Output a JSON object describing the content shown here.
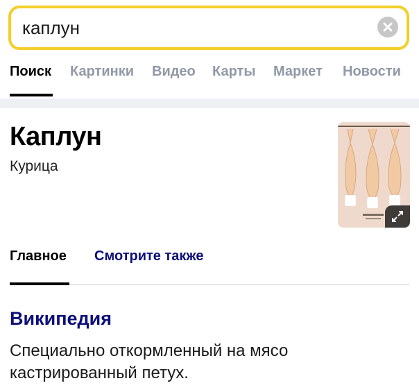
{
  "search": {
    "query": "каплун",
    "clear_icon": "clear-icon"
  },
  "tabs": [
    {
      "label": "Поиск",
      "active": true
    },
    {
      "label": "Картинки",
      "active": false
    },
    {
      "label": "Видео",
      "active": false
    },
    {
      "label": "Карты",
      "active": false
    },
    {
      "label": "Маркет",
      "active": false
    },
    {
      "label": "Новости",
      "active": false
    }
  ],
  "entity": {
    "title": "Каплун",
    "subtitle": "Курица",
    "image_icon": "poultry-image",
    "expand_icon": "expand-icon"
  },
  "card_tabs": [
    {
      "label": "Главное",
      "active": true
    },
    {
      "label": "Смотрите также",
      "active": false
    }
  ],
  "wiki": {
    "source": "Википедия",
    "text": "Специально откормленный на мясо кастрированный петух."
  },
  "colors": {
    "search_border": "#f3cf2a",
    "link": "#0e0f7a",
    "inactive_tab": "#9099a5"
  }
}
